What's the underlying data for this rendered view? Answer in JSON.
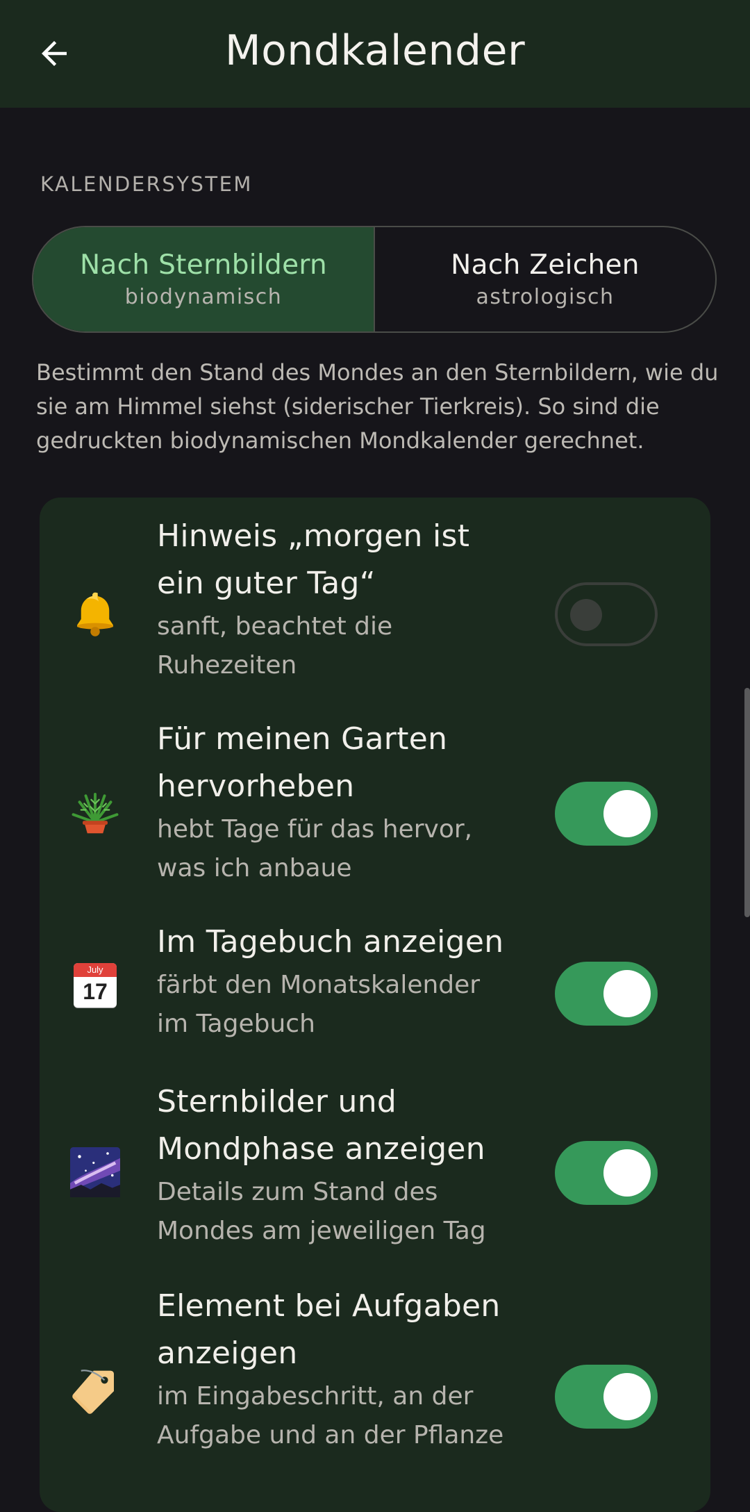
{
  "appbar": {
    "title": "Mondkalender",
    "back_icon": "arrow-left-icon"
  },
  "calendar_system": {
    "section_label": "KALENDERSYSTEM",
    "options": [
      {
        "title": "Nach Sternbildern",
        "subtitle": "biodynamisch",
        "selected": true
      },
      {
        "title": "Nach Zeichen",
        "subtitle": "astrologisch",
        "selected": false
      }
    ],
    "description": "Bestimmt den Stand des Mondes an den Sternbildern, wie du sie am Himmel siehst (siderischer Tierkreis). So sind die gedruckten biodynamischen Mondkalender gerechnet."
  },
  "settings": [
    {
      "icon": "bell-icon",
      "title": "Hinweis „morgen ist ein guter Tag“",
      "subtitle": "sanft, beachtet die Ruhezeiten",
      "enabled": false
    },
    {
      "icon": "potted-plant-icon",
      "title": "Für meinen Garten hervorheben",
      "subtitle": "hebt Tage für das hervor, was ich anbaue",
      "enabled": true
    },
    {
      "icon": "calendar-icon",
      "icon_month": "July",
      "icon_day": "17",
      "title": "Im Tagebuch anzeigen",
      "subtitle": "färbt den Monatskalender im Tagebuch",
      "enabled": true
    },
    {
      "icon": "milky-way-icon",
      "title": "Sternbilder und Mondphase anzeigen",
      "subtitle": "Details zum Stand des Mondes am jeweiligen Tag",
      "enabled": true
    },
    {
      "icon": "tag-icon",
      "title": "Element bei Aufgaben anzeigen",
      "subtitle": "im Eingabeschritt, an der Aufgabe und an der Pflanze",
      "enabled": true
    }
  ],
  "colors": {
    "background": "#16151a",
    "surface": "#1b2a1e",
    "accent": "#36995a",
    "selected_text": "#9ee0a8"
  }
}
